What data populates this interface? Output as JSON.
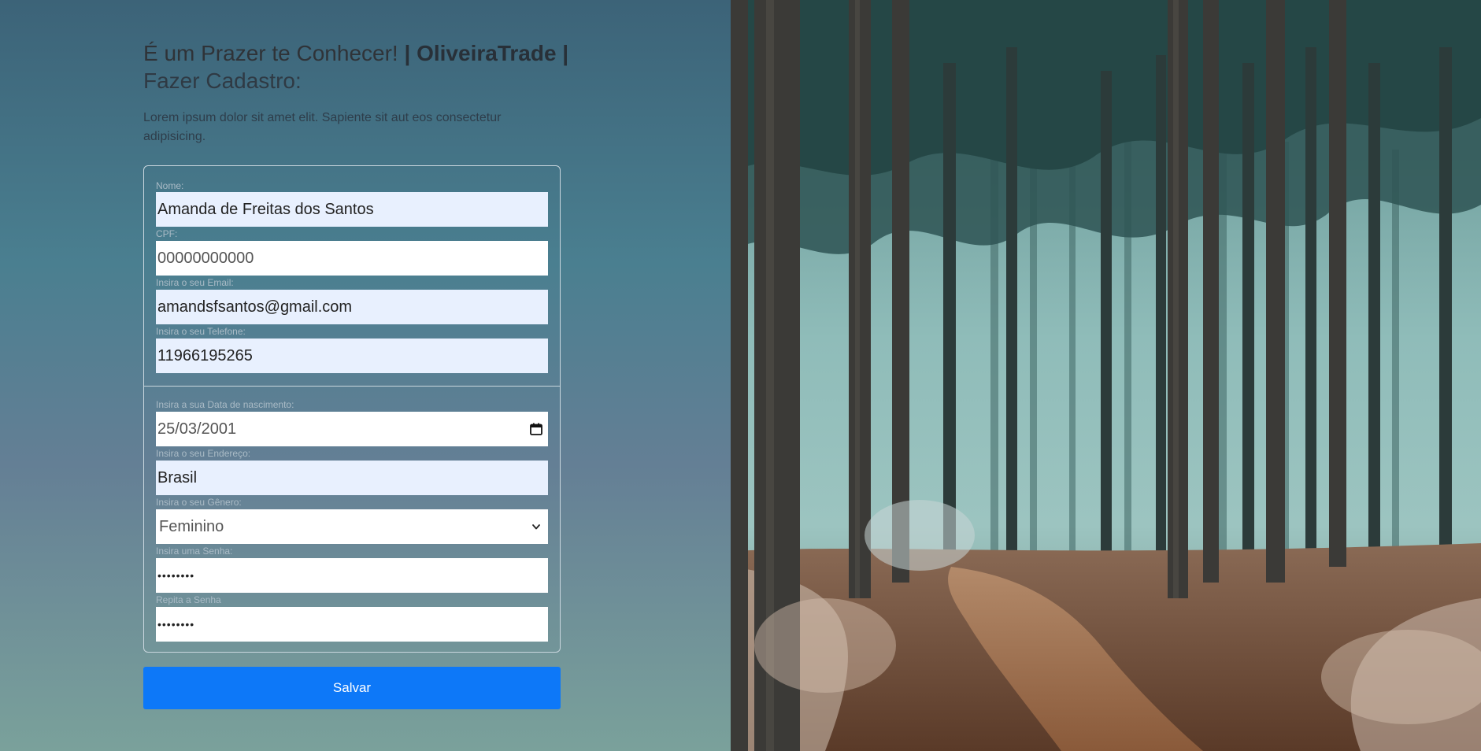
{
  "header": {
    "greeting": "É um Prazer te Conhecer!",
    "brand": "| OliveiraTrade |",
    "subtitle": "Fazer Cadastro:",
    "intro": "Lorem ipsum dolor sit amet elit. Sapiente sit aut eos consectetur adipisicing."
  },
  "form": {
    "nome": {
      "label": "Nome:",
      "value": "Amanda de Freitas dos Santos"
    },
    "cpf": {
      "label": "CPF:",
      "value": "00000000000"
    },
    "email": {
      "label": "Insira o seu Email:",
      "value": "amandsfsantos@gmail.com"
    },
    "telefone": {
      "label": "Insira o seu Telefone:",
      "value": "11966195265"
    },
    "nascimento": {
      "label": "Insira a sua Data de nascimento:",
      "value": "25/03/2001"
    },
    "endereco": {
      "label": "Insira o seu Endereço:",
      "value": "Brasil"
    },
    "genero": {
      "label": "Insira o seu Gênero:",
      "value": "Feminino"
    },
    "senha": {
      "label": "Insira uma Senha:",
      "value": "••••••••"
    },
    "repita_senha": {
      "label": "Repita a Senha",
      "value": "••••••••"
    },
    "save_label": "Salvar"
  },
  "icons": {
    "date": "calendar-icon",
    "select": "chevron-down-icon"
  },
  "colors": {
    "button": "#0d78f8",
    "autofill": "#e8f0fe"
  }
}
